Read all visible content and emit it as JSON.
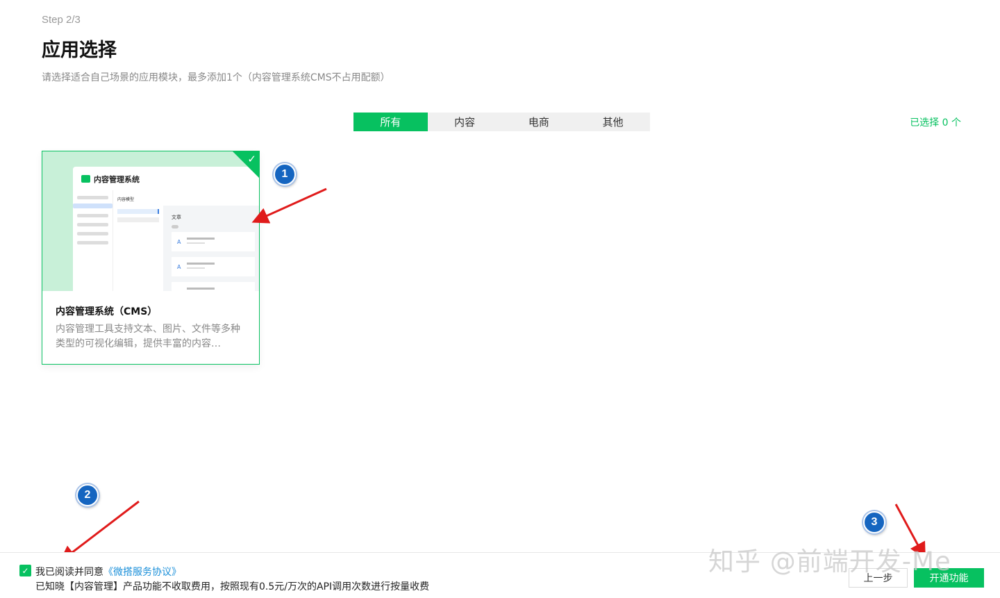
{
  "header": {
    "step": "Step 2/3",
    "title": "应用选择",
    "subtitle": "请选择适合自己场景的应用模块，最多添加1个（内容管理系统CMS不占用配额）"
  },
  "tabs": [
    {
      "label": "所有",
      "active": true
    },
    {
      "label": "内容",
      "active": false
    },
    {
      "label": "电商",
      "active": false
    },
    {
      "label": "其他",
      "active": false
    }
  ],
  "selected_count": "已选择 0 个",
  "card": {
    "preview_title": "内容管理系统",
    "preview_column_header": "内容模型",
    "preview_panel_title": "文章",
    "name": "内容管理系统（CMS）",
    "description": "内容管理工具支持文本、图片、文件等多种类型的可视化编辑，提供丰富的内容…",
    "selected": true
  },
  "markers": [
    "1",
    "2",
    "3"
  ],
  "footer": {
    "agree_text": "我已阅读并同意",
    "agree_link": "《微搭服务协议》",
    "agree_checked": true,
    "fee_text": "已知晓【内容管理】产品功能不收取费用，按照现有0.5元/万次的API调用次数进行按量收费",
    "prev_label": "上一步",
    "next_label": "开通功能"
  },
  "watermark": "知乎 @前端开发-Me",
  "colors": {
    "accent": "#07c160",
    "link": "#1a8fd9",
    "marker": "#1565c0",
    "arrow": "#e01b1b"
  }
}
